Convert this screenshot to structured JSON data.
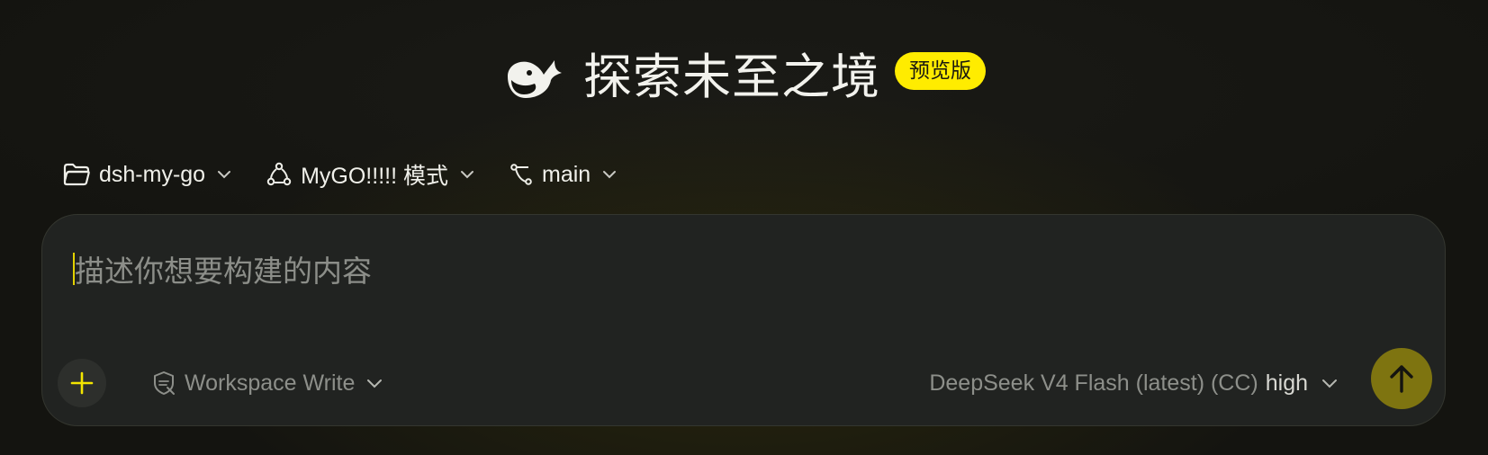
{
  "header": {
    "title": "探索未至之境",
    "badge": "预览版"
  },
  "selectors": {
    "project": "dsh-my-go",
    "mode": "MyGO!!!!! 模式",
    "branch": "main"
  },
  "composer": {
    "placeholder": "描述你想要构建的内容",
    "permission": "Workspace Write",
    "model": "DeepSeek V4 Flash (latest) (CC)",
    "effort": "high"
  },
  "colors": {
    "accent": "#ffec00",
    "send_button": "#7e7410",
    "composer_bg": "#212321"
  },
  "icons": {
    "logo": "whale-logo-icon",
    "project": "folder-icon",
    "mode": "share-nodes-icon",
    "branch": "git-branch-icon",
    "add": "plus-icon",
    "permission": "shield-icon",
    "send": "arrow-up-icon"
  }
}
